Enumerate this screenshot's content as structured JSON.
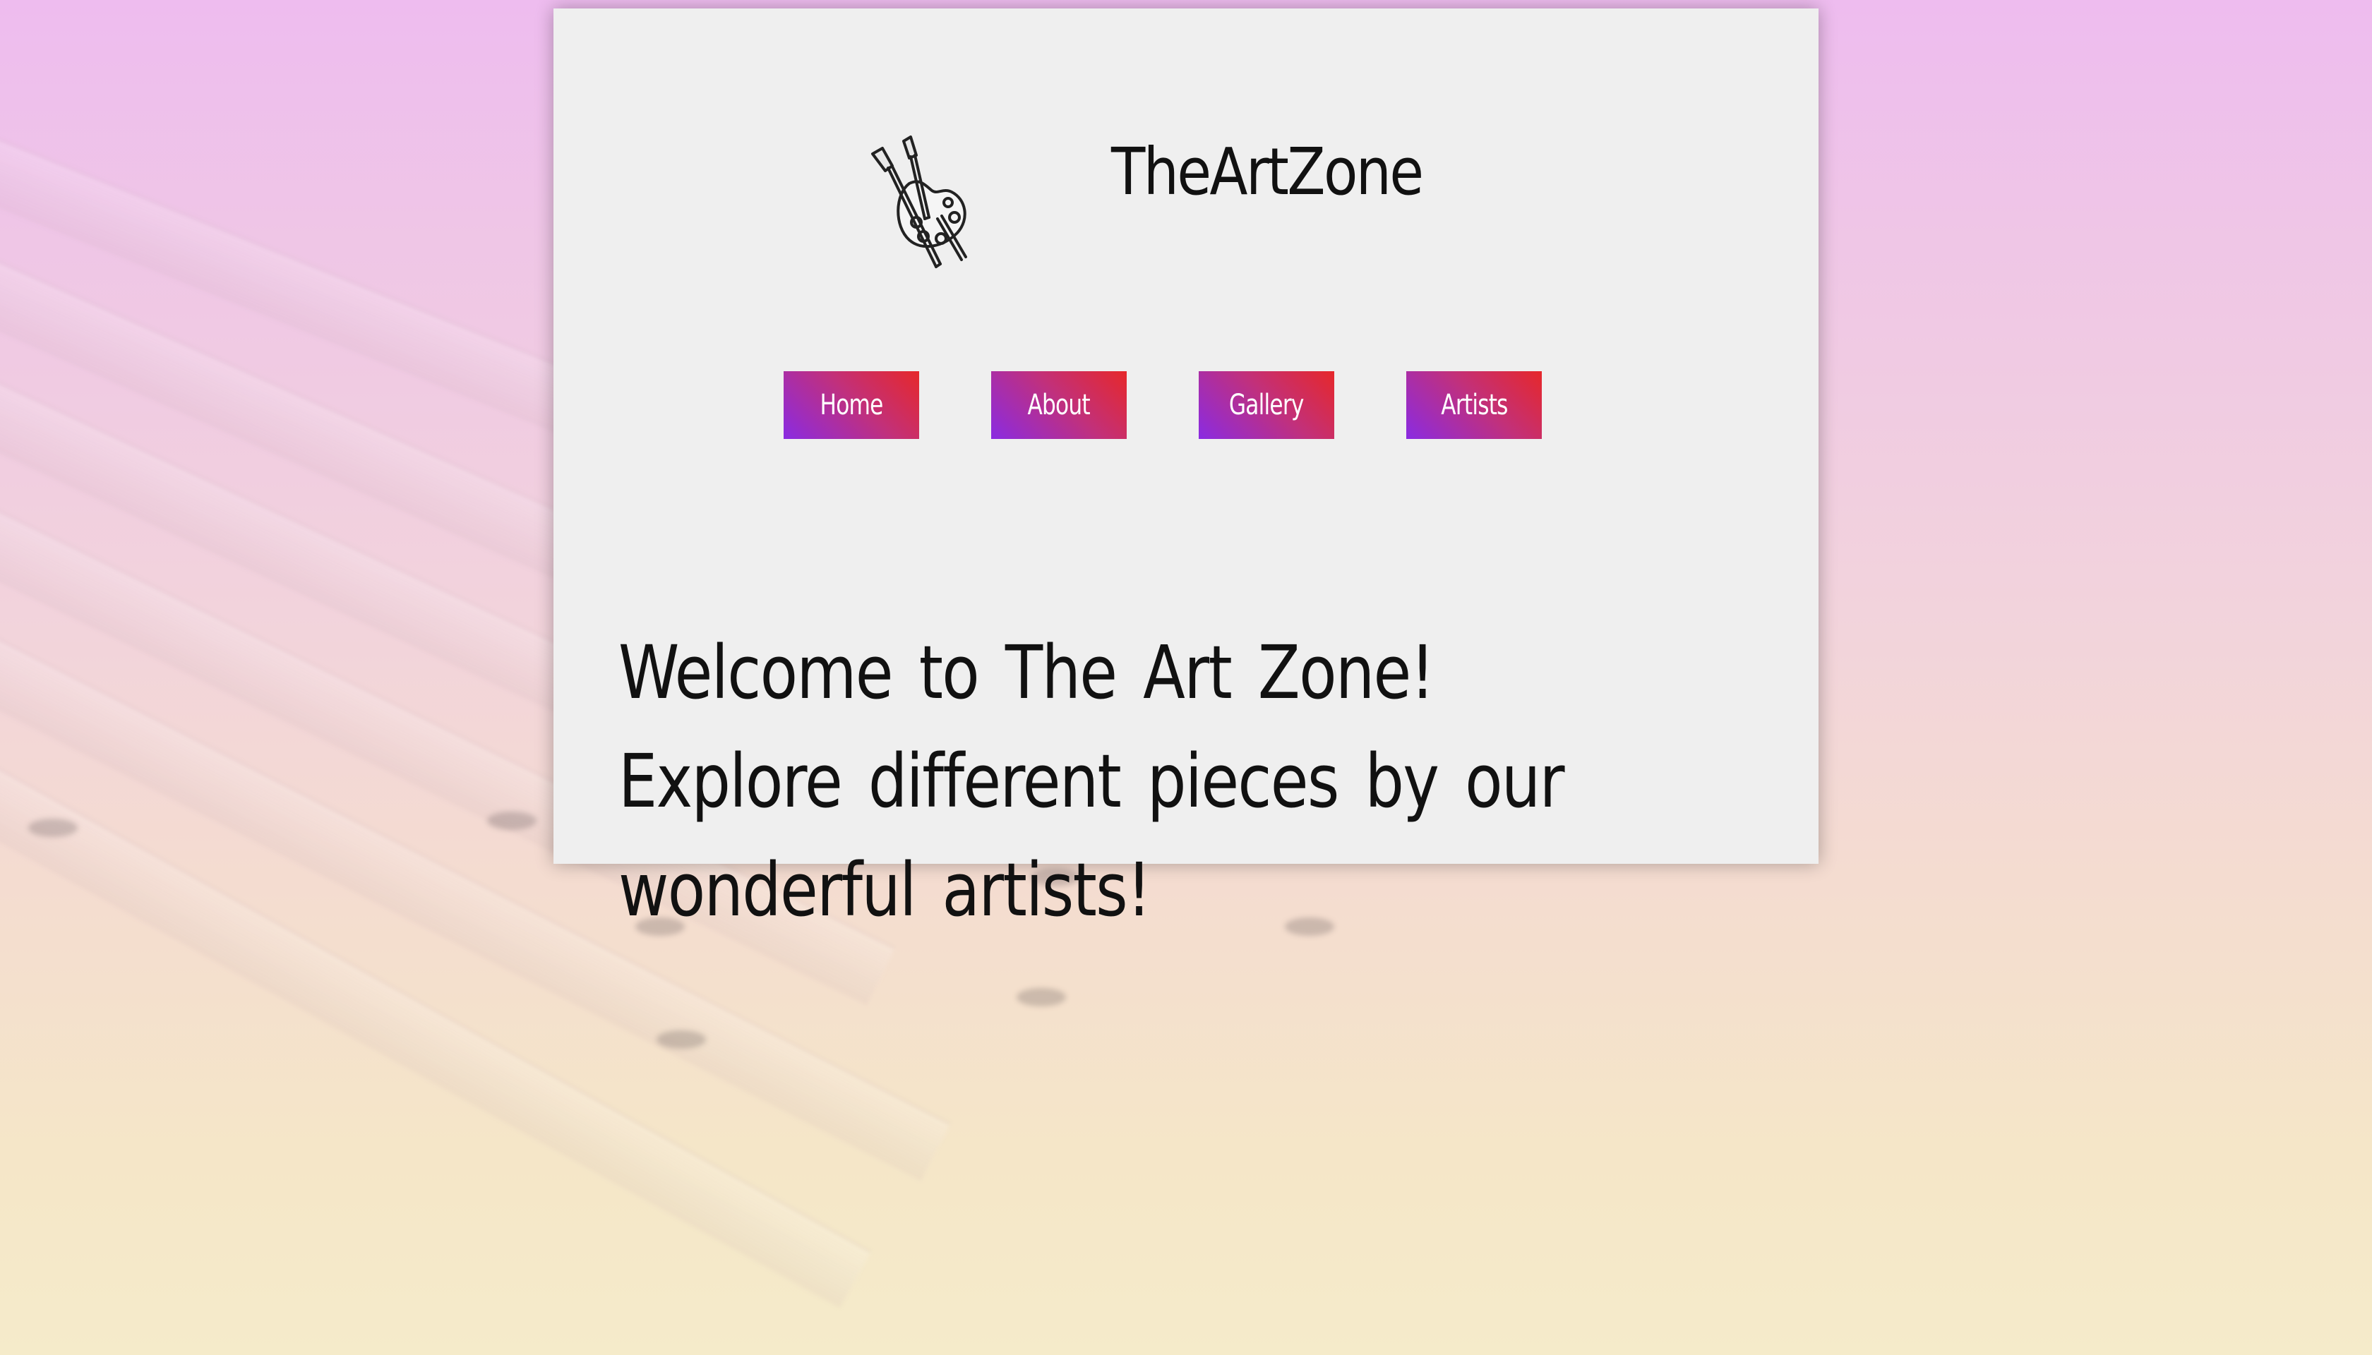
{
  "site": {
    "title": "TheArtZone",
    "logo_icon": "palette-brushes-icon"
  },
  "nav": {
    "items": [
      {
        "label": "Home"
      },
      {
        "label": "About"
      },
      {
        "label": "Gallery"
      },
      {
        "label": "Artists"
      }
    ]
  },
  "main": {
    "welcome_text": "Welcome to The Art Zone! Explore different pieces by our wonderful artists!"
  },
  "colors": {
    "button_gradient_start": "#8a2be2",
    "button_gradient_end": "#e6282a",
    "card_background": "#efefef",
    "text": "#111111"
  }
}
